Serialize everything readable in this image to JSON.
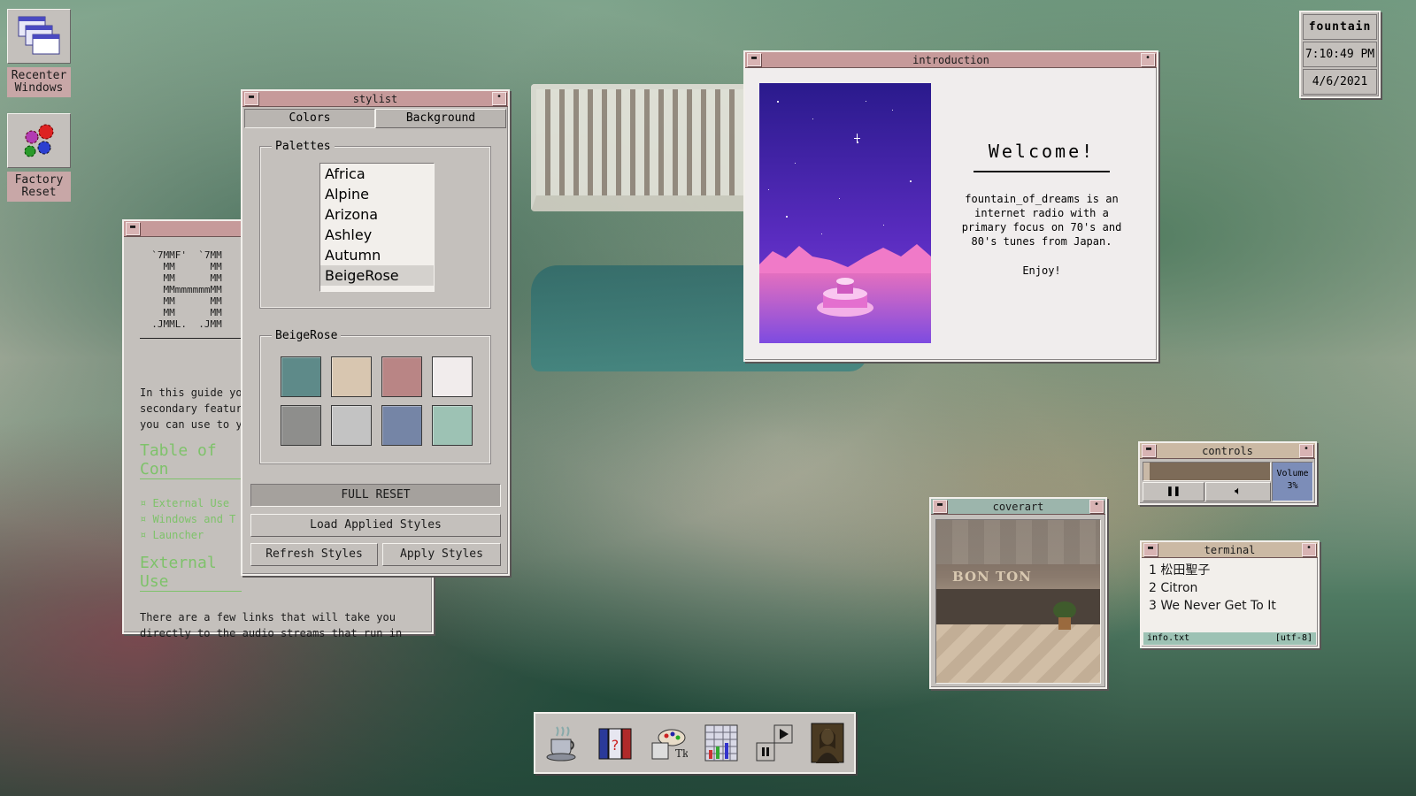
{
  "desktop_icons": [
    {
      "label": "Recenter\nWindows",
      "icon": "windows-stack-icon"
    },
    {
      "label": "Factory\nReset",
      "icon": "gears-icon"
    }
  ],
  "clock": {
    "app": "fountain",
    "time": "7:10:49 PM",
    "date": "4/6/2021"
  },
  "stylist": {
    "title": "stylist",
    "tabs": [
      "Colors",
      "Background"
    ],
    "palettes_label": "Palettes",
    "palettes": [
      "Africa",
      "Alpine",
      "Arizona",
      "Ashley",
      "Autumn",
      "BeigeRose"
    ],
    "selected_palette": "BeigeRose",
    "swatches": [
      "#5e8a89",
      "#d8c6b0",
      "#b98585",
      "#f1ecec",
      "#8e8e8c",
      "#c3c3c3",
      "#7585a6",
      "#9dc2b4"
    ],
    "buttons": {
      "full_reset": "FULL RESET",
      "load_applied": "Load Applied Styles",
      "refresh": "Refresh Styles",
      "apply": "Apply Styles"
    }
  },
  "guide": {
    "ascii_art": "  `7MMF'  `7MM\n    MM      MM\n    MM      MM\n    MMmmmmmmMM\n    MM      MM\n    MM      MM\n  .JMML.  .JMM",
    "intro_lines": [
      "In this guide you",
      "secondary feature",
      "you can use to yo"
    ],
    "toc_heading": "Table of Con",
    "toc_items": [
      "External Use",
      "Windows and T",
      "Launcher"
    ],
    "section_heading": "External Use",
    "section_lines": [
      "There are a few links that will take you",
      "directly to the audio streams that run in"
    ]
  },
  "introduction": {
    "title": "introduction",
    "welcome": "Welcome!",
    "body": "fountain_of_dreams is an internet radio with a primary focus on 70's and 80's tunes from Japan.",
    "enjoy": "Enjoy!"
  },
  "controls": {
    "title": "controls",
    "volume_label": "Volume",
    "volume_value": "3%",
    "progress": 0.05
  },
  "coverart": {
    "title": "coverart",
    "sign_text": "BON TON"
  },
  "terminal": {
    "title": "terminal",
    "lines": [
      "1 松田聖子",
      "2 Citron",
      "3 We Never Get To It"
    ],
    "status_left": "info.txt",
    "status_right": "[utf-8]"
  },
  "dock": [
    "coffee-icon",
    "books-icon",
    "paint-icon",
    "grid-icon",
    "media-icon",
    "portrait-icon"
  ]
}
